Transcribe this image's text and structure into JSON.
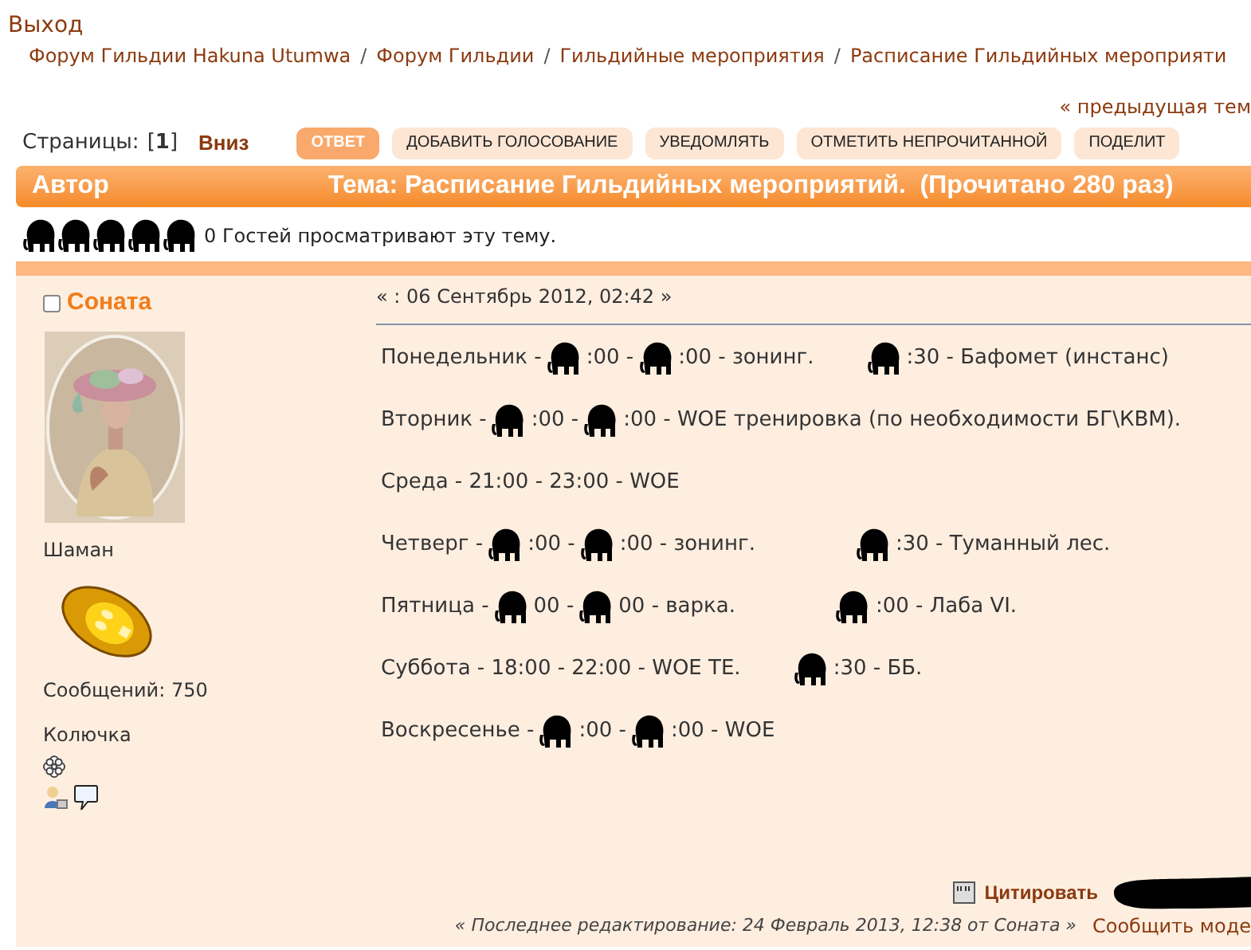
{
  "logout_link": "Выход",
  "breadcrumbs": [
    "Форум Гильдии Hakuna Utumwa",
    "Форум Гильдии",
    "Гильдийные мероприятия",
    "Расписание Гильдийных мероприяти"
  ],
  "breadcrumb_separator": "/",
  "prev_topic_link": "« предыдущая тем",
  "pages": {
    "label": "Страницы:",
    "current": "[**1**]",
    "down_link": "Вниз"
  },
  "buttons": [
    {
      "label": "ОТВЕТ",
      "kind": "primary"
    },
    {
      "label": "ДОБАВИТЬ ГОЛОСОВАНИЕ",
      "kind": "normal"
    },
    {
      "label": "УВЕДОМЛЯТЬ",
      "kind": "normal"
    },
    {
      "label": "ОТМЕТИТЬ НЕПРОЧИТАННОЙ",
      "kind": "normal"
    },
    {
      "label": "ПОДЕЛИТ",
      "kind": "normal"
    }
  ],
  "header": {
    "author": "Автор",
    "topic": "Тема: Расписание Гильдийных мероприятий.  (Прочитано 280 раз)"
  },
  "viewers": {
    "text": "0 Гостей просматривают эту тему."
  },
  "post": {
    "author": {
      "name": "Соната",
      "online": false,
      "rank": "Шаман",
      "posts": "Сообщений: 750",
      "custom_title": "Колючка"
    },
    "date": "« : 06 Сентябрь 2012, 02:42 »",
    "lines": [
      [
        {
          "kind": "text",
          "text": "Понедельник -"
        },
        {
          "kind": "blot"
        },
        {
          "kind": "text",
          "text": ":00 -"
        },
        {
          "kind": "blot"
        },
        {
          "kind": "text",
          "text": ":00 - зонинг."
        },
        {
          "kind": "gap"
        },
        {
          "kind": "blot"
        },
        {
          "kind": "text",
          "text": ":30 - Бафомет (инстанс)"
        }
      ],
      [
        {
          "kind": "text",
          "text": "Вторник -"
        },
        {
          "kind": "blot"
        },
        {
          "kind": "text",
          "text": ":00 -"
        },
        {
          "kind": "blot"
        },
        {
          "kind": "text",
          "text": ":00 - WOE тренировка (по необходимости БГ\\КВМ)."
        }
      ],
      [
        {
          "kind": "text",
          "text": "Среда - 21:00 - 23:00 - WOE"
        }
      ],
      [
        {
          "kind": "text",
          "text": "Четверг -"
        },
        {
          "kind": "blot"
        },
        {
          "kind": "text",
          "text": ":00 -"
        },
        {
          "kind": "blot"
        },
        {
          "kind": "text",
          "text": ":00 - зонинг."
        },
        {
          "kind": "gap"
        },
        {
          "kind": "gap"
        },
        {
          "kind": "blot"
        },
        {
          "kind": "text",
          "text": ":30 - Туманный лес."
        }
      ],
      [
        {
          "kind": "text",
          "text": "Пятница -"
        },
        {
          "kind": "blot"
        },
        {
          "kind": "text",
          "text": "00 -"
        },
        {
          "kind": "blot"
        },
        {
          "kind": "text",
          "text": "00 - варка."
        },
        {
          "kind": "gap"
        },
        {
          "kind": "gap"
        },
        {
          "kind": "blot"
        },
        {
          "kind": "text",
          "text": ":00 - Лаба VI."
        }
      ],
      [
        {
          "kind": "text",
          "text": "Суббота - 18:00 - 22:00 - WOE TE."
        },
        {
          "kind": "gap"
        },
        {
          "kind": "blot"
        },
        {
          "kind": "text",
          "text": ":30 - ББ."
        }
      ],
      [
        {
          "kind": "text",
          "text": "Воскресенье -"
        },
        {
          "kind": "blot"
        },
        {
          "kind": "text",
          "text": ":00 -"
        },
        {
          "kind": "blot"
        },
        {
          "kind": "text",
          "text": ":00 - WOE"
        }
      ]
    ],
    "quote_button": "Цитировать",
    "last_edit": "« Последнее редактирование: 24 Февраль 2013, 12:38 от Соната »",
    "report_link": "Сообщить моде"
  }
}
